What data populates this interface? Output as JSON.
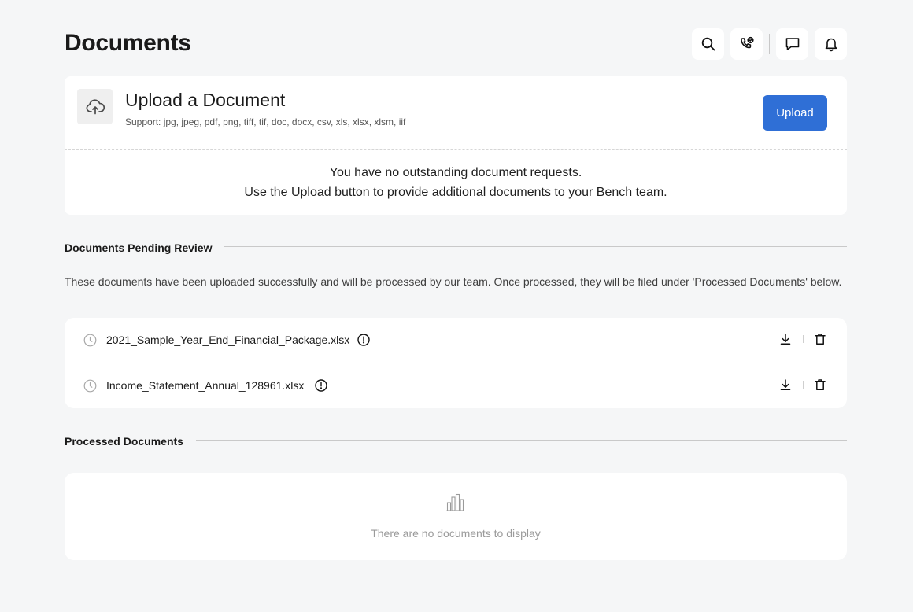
{
  "header": {
    "title": "Documents",
    "actions": [
      {
        "icon": "search-icon"
      },
      {
        "icon": "phone-call-icon"
      },
      {
        "icon": "chat-icon"
      },
      {
        "icon": "bell-icon"
      }
    ]
  },
  "upload": {
    "title": "Upload a Document",
    "support": "Support: jpg, jpeg, pdf, png, tiff, tif, doc, docx, csv, xls, xlsx, xlsm, iif",
    "button_label": "Upload",
    "message_line1": "You have no outstanding document requests.",
    "message_line2": "Use the Upload button to provide additional documents to your Bench team."
  },
  "pending": {
    "title": "Documents Pending Review",
    "description": "These documents have been uploaded successfully and will be processed by our team. Once processed, they will be filed under 'Processed Documents' below.",
    "files": [
      {
        "name": "2021_Sample_Year_End_Financial_Package.xlsx"
      },
      {
        "name": "Income_Statement_Annual_128961.xlsx"
      }
    ]
  },
  "processed": {
    "title": "Processed Documents",
    "empty_text": "There are no documents to display"
  },
  "colors": {
    "accent": "#2f6fd6",
    "background": "#f5f6f7"
  }
}
